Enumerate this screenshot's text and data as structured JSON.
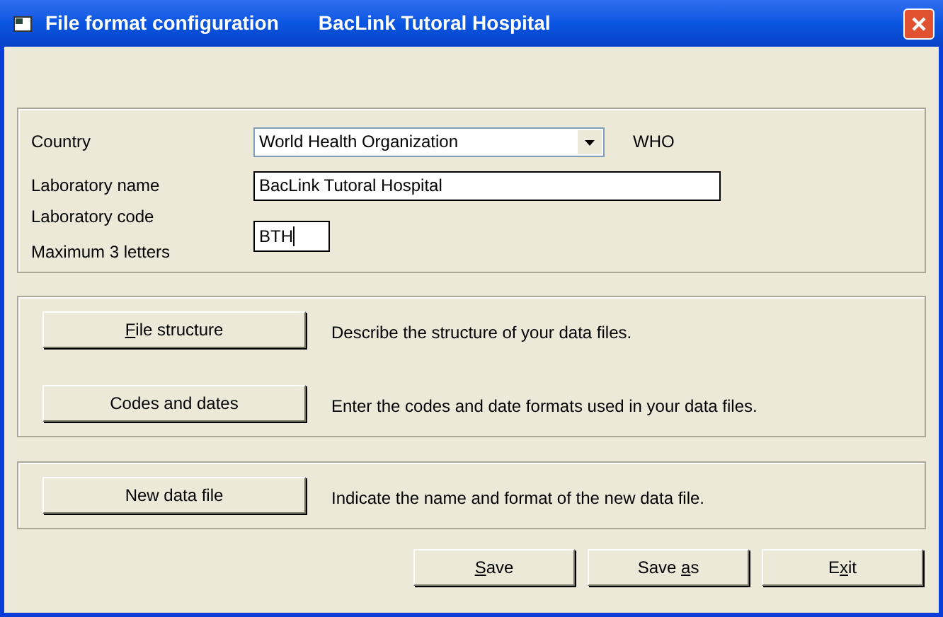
{
  "window": {
    "title": "File format configuration",
    "subtitle": "BacLink Tutoral Hospital"
  },
  "laboratory": {
    "country_label": "Country",
    "country_value": "World Health Organization",
    "country_code": "WHO",
    "name_label": "Laboratory name",
    "name_value": "BacLink Tutoral Hospital",
    "code_label": "Laboratory code",
    "code_hint": "Maximum 3 letters",
    "code_value": "BTH",
    "code_focused": true
  },
  "sections": [
    {
      "actions": [
        {
          "label": [
            {
              "text": "F",
              "underlined": true
            },
            {
              "text": "ile structure",
              "underlined": false
            }
          ],
          "description": "Describe the structure of your data files."
        },
        {
          "label": [
            {
              "text": "Codes and dates",
              "underlined": false
            }
          ],
          "description": "Enter the codes and date formats used in your data files."
        }
      ]
    },
    {
      "actions": [
        {
          "label": [
            {
              "text": "New data file",
              "underlined": false
            }
          ],
          "description": "Indicate the name and format of the new data file."
        }
      ]
    }
  ],
  "buttons": [
    {
      "label": [
        {
          "text": "S",
          "underlined": true
        },
        {
          "text": "ave",
          "underlined": false
        }
      ]
    },
    {
      "label": [
        {
          "text": "Save ",
          "underlined": false
        },
        {
          "text": "a",
          "underlined": true
        },
        {
          "text": "s",
          "underlined": false
        }
      ]
    },
    {
      "label": [
        {
          "text": "E",
          "underlined": false
        },
        {
          "text": "x",
          "underlined": true
        },
        {
          "text": "it",
          "underlined": false
        }
      ]
    }
  ]
}
